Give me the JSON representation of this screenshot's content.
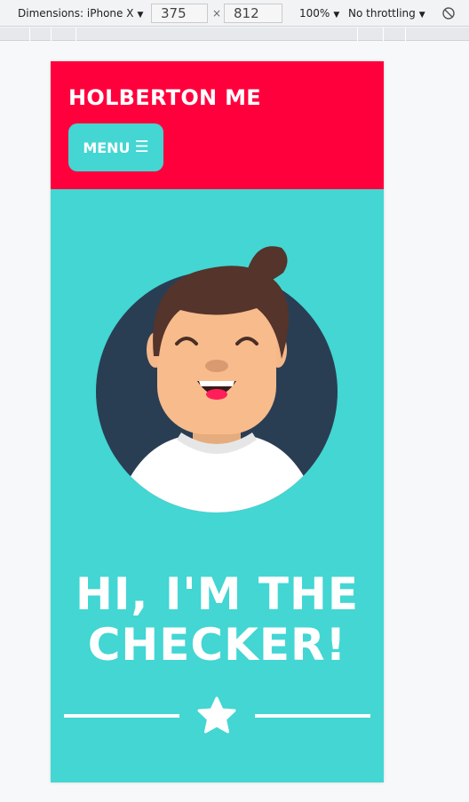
{
  "devtools": {
    "device_label": "Dimensions: iPhone X",
    "width": "375",
    "times": "×",
    "height": "812",
    "zoom": "100%",
    "throttling": "No throttling",
    "caret": "▼"
  },
  "header": {
    "title": "HOLBERTON ME",
    "menu_label": "MENU",
    "menu_icon": "☰"
  },
  "hero": {
    "title_line1": "HI, I'M THE",
    "title_line2": "CHECKER!"
  },
  "colors": {
    "header_bg": "#ff003c",
    "page_bg": "#43d6d3",
    "avatar_circle": "#2a3e53"
  },
  "icons": {
    "menu": "hamburger-icon",
    "divider": "star-icon"
  }
}
